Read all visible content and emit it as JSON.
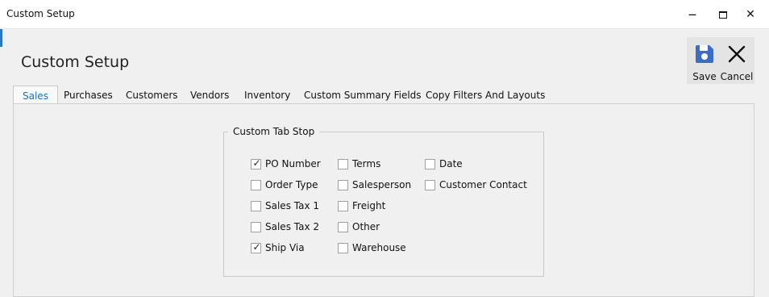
{
  "window": {
    "title": "Custom Setup",
    "minimize_glyph": "—",
    "maximize_glyph": "☐",
    "close_glyph": "✕"
  },
  "page": {
    "title": "Custom Setup"
  },
  "toolbar": {
    "save_label": "Save",
    "cancel_label": "Cancel",
    "save_icon": "save-icon",
    "cancel_icon": "close-icon",
    "accent_color": "#3d6cc6"
  },
  "tabs": [
    {
      "label": "Sales",
      "active": true
    },
    {
      "label": "Purchases"
    },
    {
      "label": "Customers"
    },
    {
      "label": "Vendors"
    },
    {
      "label": "Inventory"
    },
    {
      "label": "Custom Summary Fields"
    },
    {
      "label": "Copy Filters And Layouts"
    }
  ],
  "group": {
    "title": "Custom Tab Stop",
    "checkboxes": [
      {
        "label": "PO Number",
        "checked": true
      },
      {
        "label": "Order Type",
        "checked": false
      },
      {
        "label": "Sales Tax 1",
        "checked": false
      },
      {
        "label": "Sales Tax 2",
        "checked": false
      },
      {
        "label": "Ship Via",
        "checked": true
      },
      {
        "label": "Terms",
        "checked": false
      },
      {
        "label": "Salesperson",
        "checked": false
      },
      {
        "label": "Freight",
        "checked": false
      },
      {
        "label": "Other",
        "checked": false
      },
      {
        "label": "Warehouse",
        "checked": false
      },
      {
        "label": "Date",
        "checked": false
      },
      {
        "label": "Customer Contact",
        "checked": false
      }
    ]
  }
}
